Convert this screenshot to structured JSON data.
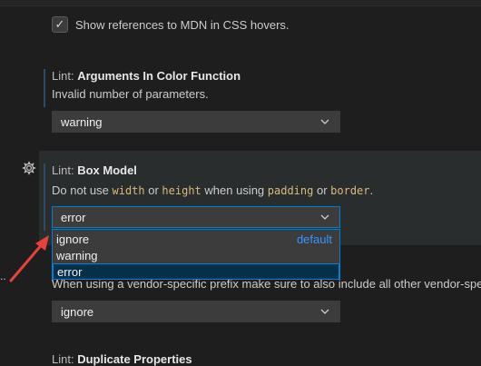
{
  "checkbox": {
    "checked": true,
    "label": "Show references to MDN in CSS hovers."
  },
  "settings": [
    {
      "category": "Lint: ",
      "name": "Arguments In Color Function",
      "description": "Invalid number of parameters.",
      "value": "warning"
    },
    {
      "category": "Lint: ",
      "name": "Box Model",
      "description_parts": [
        "Do not use ",
        "width",
        " or ",
        "height",
        " when using ",
        "padding",
        " or ",
        "border",
        "."
      ],
      "value": "error",
      "dropdown_options": [
        {
          "label": "ignore",
          "badge": "default"
        },
        {
          "label": "warning",
          "badge": ""
        },
        {
          "label": "error",
          "badge": "",
          "selected": true
        }
      ]
    },
    {
      "description": "When using a vendor-specific prefix make sure to also include all other vendor-spe",
      "value": "ignore"
    },
    {
      "category": "Lint: ",
      "name": "Duplicate Properties"
    }
  ],
  "dots_text": "..",
  "colors": {
    "focus_border": "#007fd4",
    "code_text": "#d7ba7d",
    "default_badge": "#3794ff",
    "annotation_arrow": "#e8413a"
  }
}
